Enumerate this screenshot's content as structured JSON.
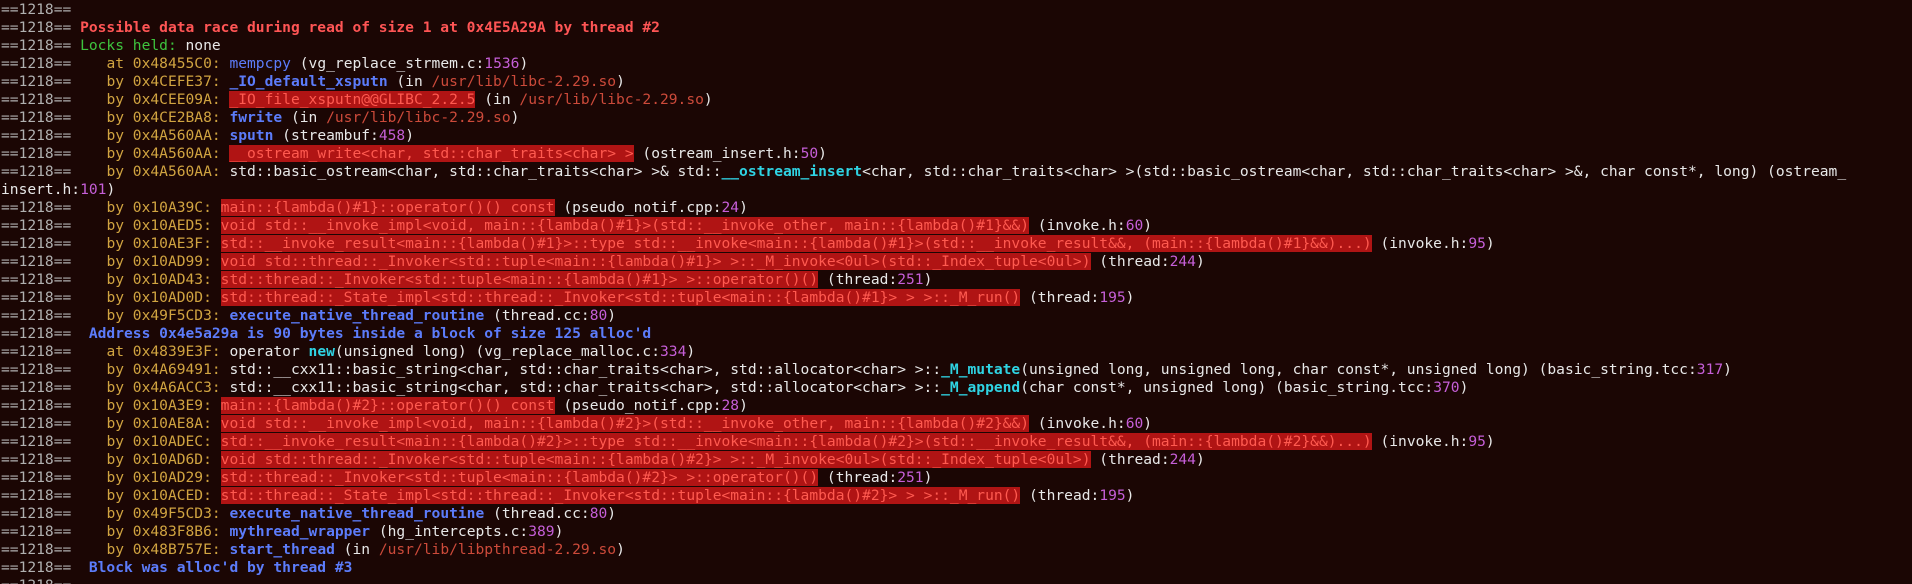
{
  "colors": {
    "background": "#1b0604",
    "pid": "#b0b0b0",
    "default": "#e8e8e8",
    "error": "#ff5555",
    "green": "#3ec43e",
    "address": "#d1a441",
    "function": "#5c7cfa",
    "number": "#c65fd8",
    "path": "#cc4a3a",
    "bold_cyan": "#2fd3e3",
    "highlight_bg": "#b01414",
    "highlight_fg": "#ff5a50"
  },
  "terminal": {
    "lines": [
      {
        "segs": [
          [
            "pid",
            "==1218=="
          ]
        ]
      },
      {
        "segs": [
          [
            "pid",
            "==1218== "
          ],
          [
            "error",
            "Possible data race during read of size 1 at 0x4E5A29A by thread #2",
            {
              "bold": true
            }
          ]
        ]
      },
      {
        "segs": [
          [
            "pid",
            "==1218== "
          ],
          [
            "green",
            "Locks held: "
          ],
          [
            "default",
            "none"
          ]
        ]
      },
      {
        "segs": [
          [
            "pid",
            "==1218==    "
          ],
          [
            "address",
            "at 0x48455C0: "
          ],
          [
            "function",
            "mempcpy"
          ],
          [
            "default",
            " ("
          ],
          [
            "default",
            "vg_replace_strmem.c"
          ],
          [
            "default",
            ":"
          ],
          [
            "number",
            "1536"
          ],
          [
            "default",
            ")"
          ]
        ]
      },
      {
        "segs": [
          [
            "pid",
            "==1218==    "
          ],
          [
            "address",
            "by 0x4CEFE37: "
          ],
          [
            "function",
            "_IO_default_xsputn",
            {
              "bold": true
            }
          ],
          [
            "default",
            " (in "
          ],
          [
            "path",
            "/usr/lib/libc-2.29.so"
          ],
          [
            "default",
            ")"
          ]
        ]
      },
      {
        "segs": [
          [
            "pid",
            "==1218==    "
          ],
          [
            "address",
            "by 0x4CEE09A: "
          ],
          [
            "highlight",
            "_IO_file_xsputn@@GLIBC_2.2.5"
          ],
          [
            "default",
            " (in "
          ],
          [
            "path",
            "/usr/lib/libc-2.29.so"
          ],
          [
            "default",
            ")"
          ]
        ]
      },
      {
        "segs": [
          [
            "pid",
            "==1218==    "
          ],
          [
            "address",
            "by 0x4CE2BA8: "
          ],
          [
            "function",
            "fwrite",
            {
              "bold": true
            }
          ],
          [
            "default",
            " (in "
          ],
          [
            "path",
            "/usr/lib/libc-2.29.so"
          ],
          [
            "default",
            ")"
          ]
        ]
      },
      {
        "segs": [
          [
            "pid",
            "==1218==    "
          ],
          [
            "address",
            "by 0x4A560AA: "
          ],
          [
            "function",
            "sputn",
            {
              "bold": true
            }
          ],
          [
            "default",
            " ("
          ],
          [
            "default",
            "streambuf"
          ],
          [
            "default",
            ":"
          ],
          [
            "number",
            "458"
          ],
          [
            "default",
            ")"
          ]
        ]
      },
      {
        "segs": [
          [
            "pid",
            "==1218==    "
          ],
          [
            "address",
            "by 0x4A560AA: "
          ],
          [
            "highlight",
            "__ostream_write<char, std::char_traits<char> >"
          ],
          [
            "default",
            " ("
          ],
          [
            "default",
            "ostream_insert.h"
          ],
          [
            "default",
            ":"
          ],
          [
            "number",
            "50"
          ],
          [
            "default",
            ")"
          ]
        ]
      },
      {
        "segs": [
          [
            "pid",
            "==1218==    "
          ],
          [
            "address",
            "by 0x4A560AA: "
          ],
          [
            "default",
            "std::basic_ostream<char, std::char_traits<char> >& std::"
          ],
          [
            "bold_cyan",
            "__ostream_insert",
            {
              "bold": true
            }
          ],
          [
            "default",
            "<char, std::char_traits<char> >(std::basic_ostream<char, std::char_traits<char> >&, char const*, long) ("
          ],
          [
            "default",
            "ostream_"
          ]
        ]
      },
      {
        "segs": [
          [
            "default",
            "insert.h"
          ],
          [
            "default",
            ":"
          ],
          [
            "number",
            "101"
          ],
          [
            "default",
            ")"
          ]
        ]
      },
      {
        "segs": [
          [
            "pid",
            "==1218==    "
          ],
          [
            "address",
            "by 0x10A39C: "
          ],
          [
            "highlight",
            "main::{lambda()#1}::operator()() const"
          ],
          [
            "default",
            " ("
          ],
          [
            "default",
            "pseudo_notif.cpp"
          ],
          [
            "default",
            ":"
          ],
          [
            "number",
            "24"
          ],
          [
            "default",
            ")"
          ]
        ]
      },
      {
        "segs": [
          [
            "pid",
            "==1218==    "
          ],
          [
            "address",
            "by 0x10AED5: "
          ],
          [
            "highlight",
            "void std::__invoke_impl<void, main::{lambda()#1}>(std::__invoke_other, main::{lambda()#1}&&)"
          ],
          [
            "default",
            " ("
          ],
          [
            "default",
            "invoke.h"
          ],
          [
            "default",
            ":"
          ],
          [
            "number",
            "60"
          ],
          [
            "default",
            ")"
          ]
        ]
      },
      {
        "segs": [
          [
            "pid",
            "==1218==    "
          ],
          [
            "address",
            "by 0x10AE3F: "
          ],
          [
            "highlight",
            "std::__invoke_result<main::{lambda()#1}>::type std::__invoke<main::{lambda()#1}>(std::__invoke_result&&, (main::{lambda()#1}&&)...)"
          ],
          [
            "default",
            " ("
          ],
          [
            "default",
            "invoke.h"
          ],
          [
            "default",
            ":"
          ],
          [
            "number",
            "95"
          ],
          [
            "default",
            ")"
          ]
        ]
      },
      {
        "segs": [
          [
            "pid",
            "==1218==    "
          ],
          [
            "address",
            "by 0x10AD99: "
          ],
          [
            "highlight",
            "void std::thread::_Invoker<std::tuple<main::{lambda()#1}> >::_M_invoke<0ul>(std::_Index_tuple<0ul>)"
          ],
          [
            "default",
            " ("
          ],
          [
            "default",
            "thread"
          ],
          [
            "default",
            ":"
          ],
          [
            "number",
            "244"
          ],
          [
            "default",
            ")"
          ]
        ]
      },
      {
        "segs": [
          [
            "pid",
            "==1218==    "
          ],
          [
            "address",
            "by 0x10AD43: "
          ],
          [
            "highlight",
            "std::thread::_Invoker<std::tuple<main::{lambda()#1}> >::operator()()"
          ],
          [
            "default",
            " ("
          ],
          [
            "default",
            "thread"
          ],
          [
            "default",
            ":"
          ],
          [
            "number",
            "251"
          ],
          [
            "default",
            ")"
          ]
        ]
      },
      {
        "segs": [
          [
            "pid",
            "==1218==    "
          ],
          [
            "address",
            "by 0x10AD0D: "
          ],
          [
            "highlight",
            "std::thread::_State_impl<std::thread::_Invoker<std::tuple<main::{lambda()#1}> > >::_M_run()"
          ],
          [
            "default",
            " ("
          ],
          [
            "default",
            "thread"
          ],
          [
            "default",
            ":"
          ],
          [
            "number",
            "195"
          ],
          [
            "default",
            ")"
          ]
        ]
      },
      {
        "segs": [
          [
            "pid",
            "==1218==    "
          ],
          [
            "address",
            "by 0x49F5CD3: "
          ],
          [
            "function",
            "execute_native_thread_routine",
            {
              "bold": true
            }
          ],
          [
            "default",
            " ("
          ],
          [
            "default",
            "thread.cc"
          ],
          [
            "default",
            ":"
          ],
          [
            "number",
            "80"
          ],
          [
            "default",
            ")"
          ]
        ]
      },
      {
        "segs": [
          [
            "pid",
            "==1218== "
          ],
          [
            "function",
            " Address 0x4e5a29a is 90 bytes inside a block of size 125 alloc'd",
            {
              "bold": true
            }
          ]
        ]
      },
      {
        "segs": [
          [
            "pid",
            "==1218==    "
          ],
          [
            "address",
            "at 0x4839E3F: "
          ],
          [
            "default",
            "operator "
          ],
          [
            "bold_cyan",
            "new",
            {
              "bold": true
            }
          ],
          [
            "default",
            "(unsigned long) ("
          ],
          [
            "default",
            "vg_replace_malloc.c"
          ],
          [
            "default",
            ":"
          ],
          [
            "number",
            "334"
          ],
          [
            "default",
            ")"
          ]
        ]
      },
      {
        "segs": [
          [
            "pid",
            "==1218==    "
          ],
          [
            "address",
            "by 0x4A69491: "
          ],
          [
            "default",
            "std::__cxx11::basic_string<char, std::char_traits<char>, std::allocator<char> >::"
          ],
          [
            "bold_cyan",
            "_M_mutate",
            {
              "bold": true
            }
          ],
          [
            "default",
            "(unsigned long, unsigned long, char const*, unsigned long) ("
          ],
          [
            "default",
            "basic_string.tcc"
          ],
          [
            "default",
            ":"
          ],
          [
            "number",
            "317"
          ],
          [
            "default",
            ")"
          ]
        ]
      },
      {
        "segs": [
          [
            "pid",
            "==1218==    "
          ],
          [
            "address",
            "by 0x4A6ACC3: "
          ],
          [
            "default",
            "std::__cxx11::basic_string<char, std::char_traits<char>, std::allocator<char> >::"
          ],
          [
            "bold_cyan",
            "_M_append",
            {
              "bold": true
            }
          ],
          [
            "default",
            "(char const*, unsigned long) ("
          ],
          [
            "default",
            "basic_string.tcc"
          ],
          [
            "default",
            ":"
          ],
          [
            "number",
            "370"
          ],
          [
            "default",
            ")"
          ]
        ]
      },
      {
        "segs": [
          [
            "pid",
            "==1218==    "
          ],
          [
            "address",
            "by 0x10A3E9: "
          ],
          [
            "highlight",
            "main::{lambda()#2}::operator()() const"
          ],
          [
            "default",
            " ("
          ],
          [
            "default",
            "pseudo_notif.cpp"
          ],
          [
            "default",
            ":"
          ],
          [
            "number",
            "28"
          ],
          [
            "default",
            ")"
          ]
        ]
      },
      {
        "segs": [
          [
            "pid",
            "==1218==    "
          ],
          [
            "address",
            "by 0x10AE8A: "
          ],
          [
            "highlight",
            "void std::__invoke_impl<void, main::{lambda()#2}>(std::__invoke_other, main::{lambda()#2}&&)"
          ],
          [
            "default",
            " ("
          ],
          [
            "default",
            "invoke.h"
          ],
          [
            "default",
            ":"
          ],
          [
            "number",
            "60"
          ],
          [
            "default",
            ")"
          ]
        ]
      },
      {
        "segs": [
          [
            "pid",
            "==1218==    "
          ],
          [
            "address",
            "by 0x10ADEC: "
          ],
          [
            "highlight",
            "std::__invoke_result<main::{lambda()#2}>::type std::__invoke<main::{lambda()#2}>(std::__invoke_result&&, (main::{lambda()#2}&&)...)"
          ],
          [
            "default",
            " ("
          ],
          [
            "default",
            "invoke.h"
          ],
          [
            "default",
            ":"
          ],
          [
            "number",
            "95"
          ],
          [
            "default",
            ")"
          ]
        ]
      },
      {
        "segs": [
          [
            "pid",
            "==1218==    "
          ],
          [
            "address",
            "by 0x10AD6D: "
          ],
          [
            "highlight",
            "void std::thread::_Invoker<std::tuple<main::{lambda()#2}> >::_M_invoke<0ul>(std::_Index_tuple<0ul>)"
          ],
          [
            "default",
            " ("
          ],
          [
            "default",
            "thread"
          ],
          [
            "default",
            ":"
          ],
          [
            "number",
            "244"
          ],
          [
            "default",
            ")"
          ]
        ]
      },
      {
        "segs": [
          [
            "pid",
            "==1218==    "
          ],
          [
            "address",
            "by 0x10AD29: "
          ],
          [
            "highlight",
            "std::thread::_Invoker<std::tuple<main::{lambda()#2}> >::operator()()"
          ],
          [
            "default",
            " ("
          ],
          [
            "default",
            "thread"
          ],
          [
            "default",
            ":"
          ],
          [
            "number",
            "251"
          ],
          [
            "default",
            ")"
          ]
        ]
      },
      {
        "segs": [
          [
            "pid",
            "==1218==    "
          ],
          [
            "address",
            "by 0x10ACED: "
          ],
          [
            "highlight",
            "std::thread::_State_impl<std::thread::_Invoker<std::tuple<main::{lambda()#2}> > >::_M_run()"
          ],
          [
            "default",
            " ("
          ],
          [
            "default",
            "thread"
          ],
          [
            "default",
            ":"
          ],
          [
            "number",
            "195"
          ],
          [
            "default",
            ")"
          ]
        ]
      },
      {
        "segs": [
          [
            "pid",
            "==1218==    "
          ],
          [
            "address",
            "by 0x49F5CD3: "
          ],
          [
            "function",
            "execute_native_thread_routine",
            {
              "bold": true
            }
          ],
          [
            "default",
            " ("
          ],
          [
            "default",
            "thread.cc"
          ],
          [
            "default",
            ":"
          ],
          [
            "number",
            "80"
          ],
          [
            "default",
            ")"
          ]
        ]
      },
      {
        "segs": [
          [
            "pid",
            "==1218==    "
          ],
          [
            "address",
            "by 0x483F8B6: "
          ],
          [
            "function",
            "mythread_wrapper",
            {
              "bold": true
            }
          ],
          [
            "default",
            " ("
          ],
          [
            "default",
            "hg_intercepts.c"
          ],
          [
            "default",
            ":"
          ],
          [
            "number",
            "389"
          ],
          [
            "default",
            ")"
          ]
        ]
      },
      {
        "segs": [
          [
            "pid",
            "==1218==    "
          ],
          [
            "address",
            "by 0x48B757E: "
          ],
          [
            "function",
            "start_thread",
            {
              "bold": true
            }
          ],
          [
            "default",
            " (in "
          ],
          [
            "path",
            "/usr/lib/libpthread-2.29.so"
          ],
          [
            "default",
            ")"
          ]
        ]
      },
      {
        "segs": [
          [
            "pid",
            "==1218== "
          ],
          [
            "function",
            " Block was alloc'd by thread #3",
            {
              "bold": true
            }
          ]
        ]
      },
      {
        "segs": [
          [
            "pid",
            "==1218=="
          ]
        ]
      }
    ]
  }
}
